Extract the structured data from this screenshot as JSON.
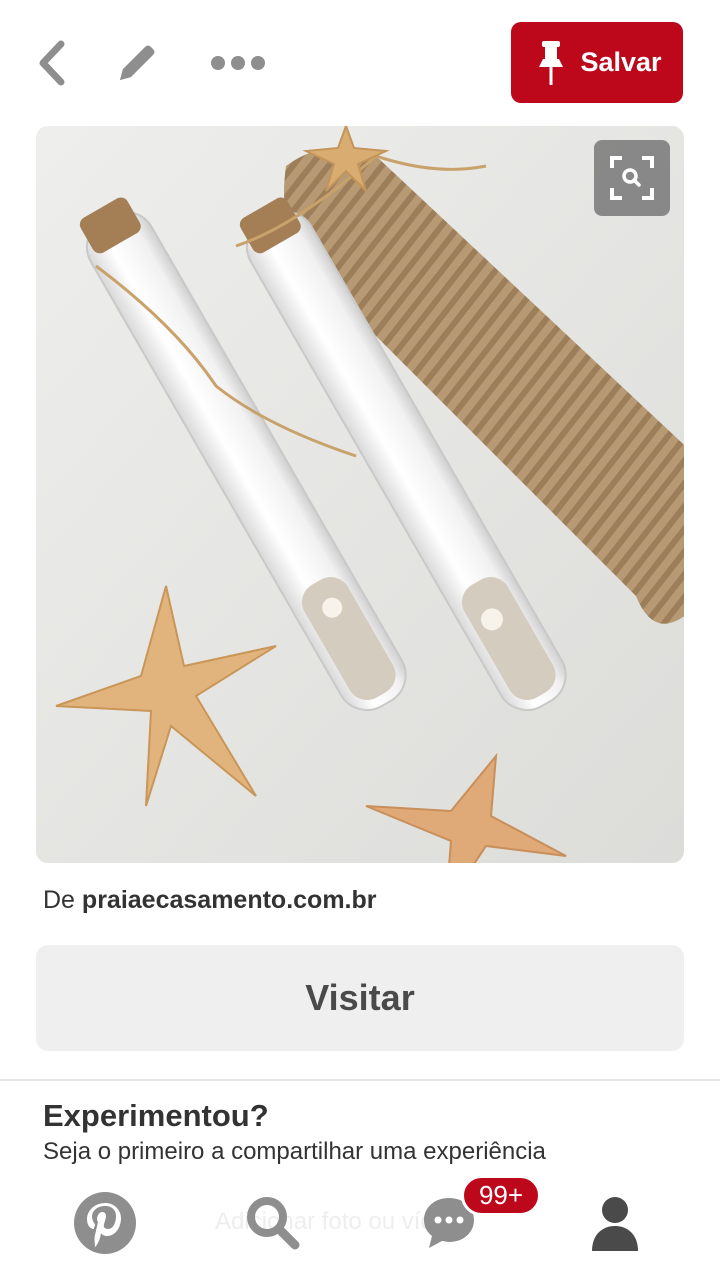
{
  "header": {
    "save_label": "Salvar",
    "icons": [
      "chevron-left-icon",
      "pencil-icon",
      "more-dots-icon",
      "pin-icon"
    ]
  },
  "pin": {
    "image_lens_icon": "visual-search-icon",
    "source_prefix": "De",
    "source_domain": "praiaecasamento.com.br",
    "visit_label": "Visitar"
  },
  "tried": {
    "title": "Experimentou?",
    "subtitle": "Seja o primeiro a compartilhar uma experiência",
    "add_photo_label": "Adicionar foto ou vídeo"
  },
  "bottom_nav": {
    "items": [
      "pinterest-home-icon",
      "search-icon",
      "messages-icon",
      "profile-icon"
    ],
    "messages_badge": "99+"
  },
  "colors": {
    "brand_red": "#bd081c",
    "icon_gray": "#8e8e8e",
    "text_dark": "#333333",
    "button_gray": "#efefef"
  }
}
